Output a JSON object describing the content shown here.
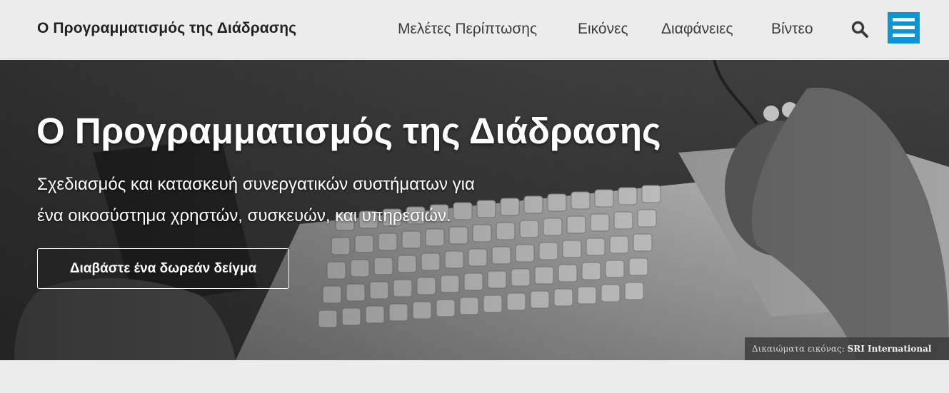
{
  "header": {
    "brand": "Ο Προγραμματισμός της Διάδρασης",
    "nav": [
      {
        "label": "Μελέτες Περίπτωσης"
      },
      {
        "label": "Εικόνες"
      },
      {
        "label": "Διαφάνειες"
      },
      {
        "label": "Βίντεο"
      }
    ],
    "search_icon": "search-icon",
    "menu_icon": "hamburger-menu-icon",
    "menu_color": "#0d94d2"
  },
  "hero": {
    "title": "Ο Προγραμματισμός της Διάδρασης",
    "subtitle_line1": "Σχεδιασμός και κατασκευή συνεργατικών συστήματων για",
    "subtitle_line2": "ένα οικοσύστημα χρηστών, συσκευών, και υπηρεσιών.",
    "cta_label": "Διαβάστε ένα δωρεάν δείγμα",
    "credit_prefix": "Δικαιώματα εικόνας:",
    "credit_owner": "SRI International"
  }
}
